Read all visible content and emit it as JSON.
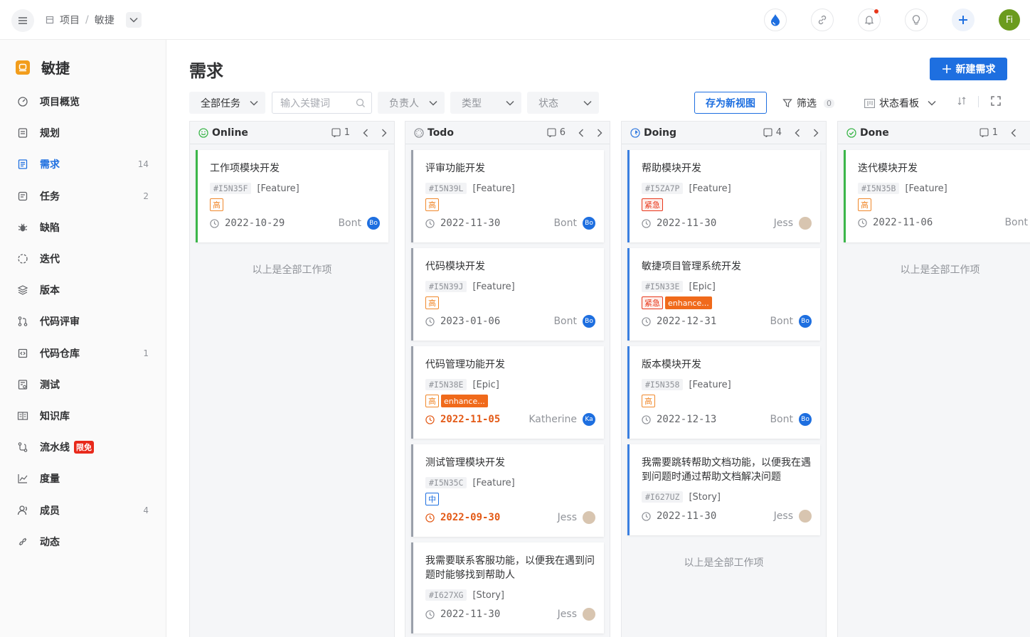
{
  "breadcrumb": {
    "project_label": "项目",
    "current": "敏捷"
  },
  "topbar": {
    "avatar_text": "Fi"
  },
  "sidebar": {
    "project_name": "敏捷",
    "items": [
      {
        "label": "项目概览",
        "count": "",
        "icon": "dashboard-icon"
      },
      {
        "label": "规划",
        "count": "",
        "icon": "plan-icon"
      },
      {
        "label": "需求",
        "count": "14",
        "icon": "requirement-icon"
      },
      {
        "label": "任务",
        "count": "2",
        "icon": "task-icon"
      },
      {
        "label": "缺陷",
        "count": "",
        "icon": "bug-icon"
      },
      {
        "label": "迭代",
        "count": "",
        "icon": "iteration-icon"
      },
      {
        "label": "版本",
        "count": "",
        "icon": "version-icon"
      },
      {
        "label": "代码评审",
        "count": "",
        "icon": "code-review-icon"
      },
      {
        "label": "代码仓库",
        "count": "1",
        "icon": "repository-icon"
      },
      {
        "label": "测试",
        "count": "",
        "icon": "test-icon"
      },
      {
        "label": "知识库",
        "count": "",
        "icon": "wiki-icon"
      },
      {
        "label": "流水线",
        "count": "",
        "icon": "pipeline-icon",
        "badge": "限免"
      },
      {
        "label": "度量",
        "count": "",
        "icon": "metrics-icon"
      },
      {
        "label": "成员",
        "count": "4",
        "icon": "members-icon"
      },
      {
        "label": "动态",
        "count": "",
        "icon": "activity-icon"
      }
    ]
  },
  "main": {
    "title": "需求",
    "new_button": "新建需求",
    "filters": {
      "all_tasks": "全部任务",
      "search_placeholder": "输入关键词",
      "assignee": "负责人",
      "type": "类型",
      "status": "状态",
      "save_view": "存为新视图",
      "filter_label": "筛选",
      "filter_count": "0",
      "board_label": "状态看板"
    }
  },
  "colors": {
    "accent": "#1e6fe0",
    "online": "#3cb64a",
    "todo": "#909399",
    "doing": "#3a7fe0",
    "done": "#3cb64a"
  },
  "columns": [
    {
      "name": "Online",
      "count": "1",
      "end_note": "以上是全部工作项",
      "cards": [
        {
          "title": "工作项模块开发",
          "id": "#I5N35F",
          "type": "[Feature]",
          "tags": [
            "高"
          ],
          "date": "2022-10-29",
          "late": false,
          "assignee": "Bont",
          "avatar": "Bo"
        }
      ]
    },
    {
      "name": "Todo",
      "count": "6",
      "cards": [
        {
          "title": "评审功能开发",
          "id": "#I5N39L",
          "type": "[Feature]",
          "tags": [
            "高"
          ],
          "date": "2022-11-30",
          "late": false,
          "assignee": "Bont",
          "avatar": "Bo"
        },
        {
          "title": "代码模块开发",
          "id": "#I5N39J",
          "type": "[Feature]",
          "tags": [
            "高"
          ],
          "date": "2023-01-06",
          "late": false,
          "assignee": "Bont",
          "avatar": "Bo"
        },
        {
          "title": "代码管理功能开发",
          "id": "#I5N38E",
          "type": "[Epic]",
          "tags": [
            "高",
            "enhance..."
          ],
          "date": "2022-11-05",
          "late": true,
          "assignee": "Katherine",
          "avatar": "Ka"
        },
        {
          "title": "测试管理模块开发",
          "id": "#I5N35C",
          "type": "[Feature]",
          "tags": [
            "中"
          ],
          "date": "2022-09-30",
          "late": true,
          "assignee": "Jess",
          "avatar": ""
        },
        {
          "title": "我需要联系客服功能，以便我在遇到问题时能够找到帮助人",
          "id": "#I627XG",
          "type": "[Story]",
          "tags": [],
          "date": "2022-11-30",
          "late": false,
          "assignee": "Jess",
          "avatar": ""
        }
      ]
    },
    {
      "name": "Doing",
      "count": "4",
      "end_note": "以上是全部工作项",
      "cards": [
        {
          "title": "帮助模块开发",
          "id": "#I5ZA7P",
          "type": "[Feature]",
          "tags": [
            "紧急"
          ],
          "date": "2022-11-30",
          "late": false,
          "assignee": "Jess",
          "avatar": ""
        },
        {
          "title": "敏捷项目管理系统开发",
          "id": "#I5N33E",
          "type": "[Epic]",
          "tags": [
            "紧急",
            "enhance..."
          ],
          "date": "2022-12-31",
          "late": false,
          "assignee": "Bont",
          "avatar": "Bo"
        },
        {
          "title": "版本模块开发",
          "id": "#I5N358",
          "type": "[Feature]",
          "tags": [
            "高"
          ],
          "date": "2022-12-13",
          "late": false,
          "assignee": "Bont",
          "avatar": "Bo"
        },
        {
          "title": "我需要跳转帮助文档功能，以便我在遇到问题时通过帮助文档解决问题",
          "id": "#I627UZ",
          "type": "[Story]",
          "tags": [],
          "date": "2022-11-30",
          "late": false,
          "assignee": "Jess",
          "avatar": ""
        }
      ]
    },
    {
      "name": "Done",
      "count": "1",
      "end_note": "以上是全部工作项",
      "cards": [
        {
          "title": "迭代模块开发",
          "id": "#I5N35B",
          "type": "[Feature]",
          "tags": [
            "高"
          ],
          "date": "2022-11-06",
          "late": false,
          "assignee": "Bont",
          "avatar": ""
        }
      ]
    }
  ]
}
